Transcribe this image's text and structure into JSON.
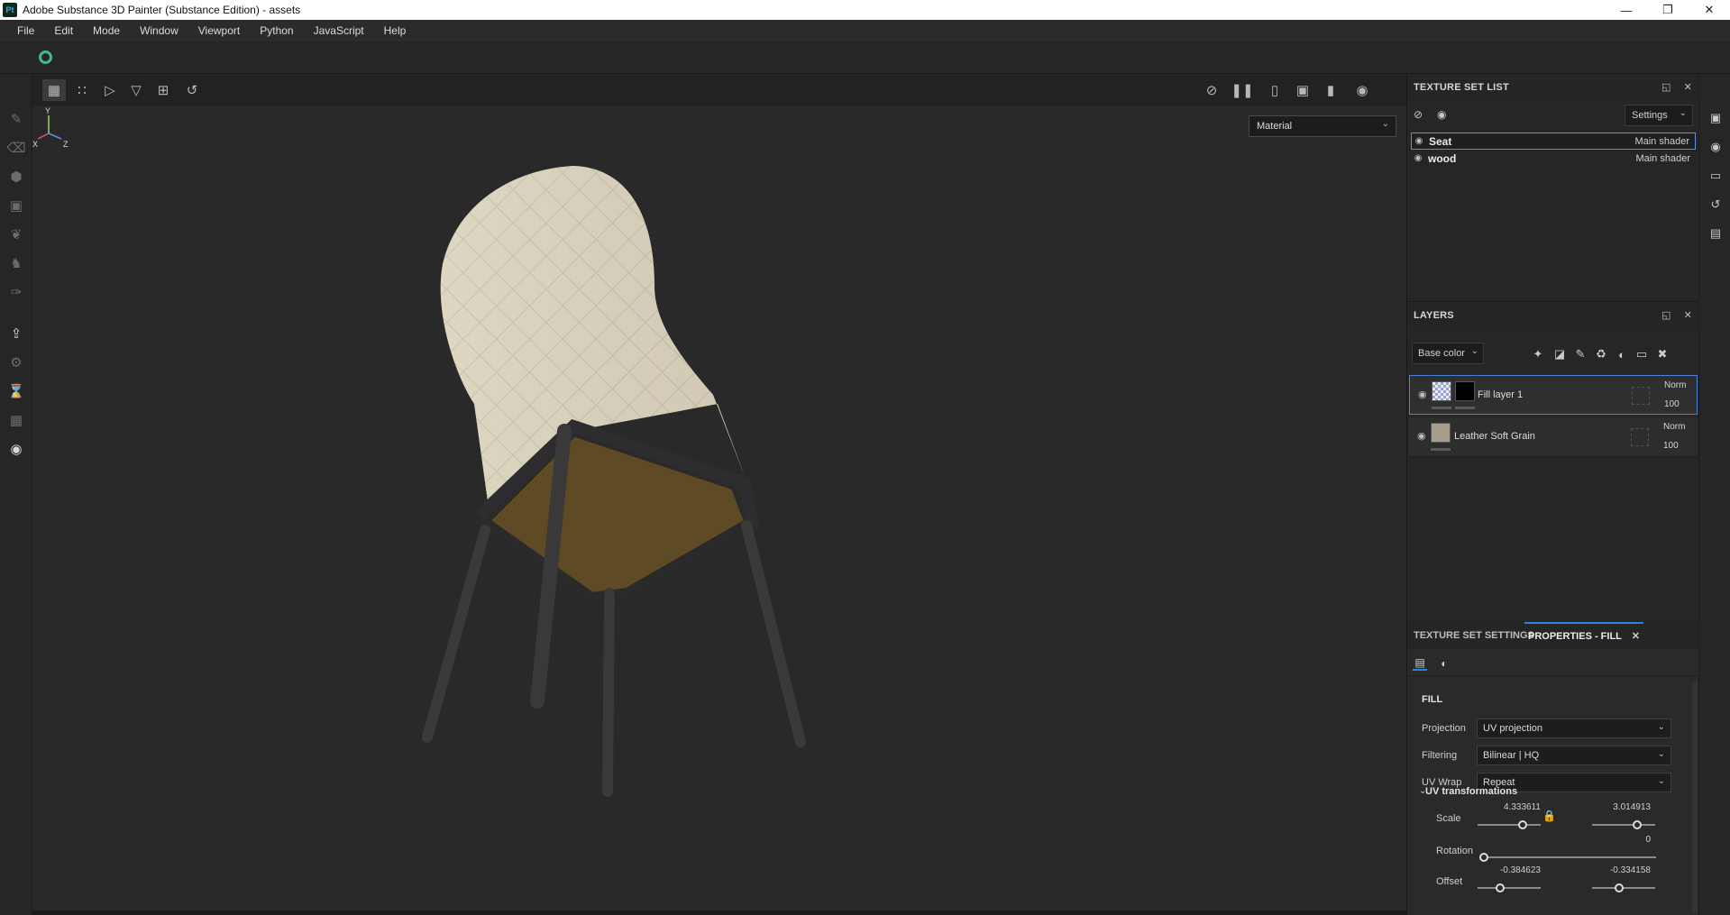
{
  "window": {
    "app_icon_text": "Pt",
    "title": "Adobe Substance 3D Painter (Substance Edition) - assets",
    "controls": [
      "minimize",
      "restore",
      "close"
    ]
  },
  "menu": [
    "File",
    "Edit",
    "Mode",
    "Window",
    "Viewport",
    "Python",
    "JavaScript",
    "Help"
  ],
  "viewport": {
    "material_dropdown": "Material",
    "axis_labels": {
      "x": "X",
      "y": "Y",
      "z": "Z"
    },
    "toolbar_left_icons": [
      "grid-view-icon",
      "multi-grid-icon",
      "mirror-x-icon",
      "mirror-y-icon",
      "add-view-icon",
      "history-icon"
    ],
    "toolbar_right_icons": [
      "hide-icon",
      "pause-icon",
      "2d-view-icon",
      "3d-view-icon",
      "camera-icon",
      "screenshot-icon"
    ]
  },
  "texture_set_list": {
    "title": "TEXTURE SET LIST",
    "settings_label": "Settings",
    "items": [
      {
        "name": "Seat",
        "shader": "Main shader",
        "selected": true
      },
      {
        "name": "wood",
        "shader": "Main shader",
        "selected": false
      }
    ]
  },
  "layers": {
    "title": "LAYERS",
    "channel": "Base color",
    "items": [
      {
        "name": "Fill layer 1",
        "blend": "Norm",
        "opacity": "100",
        "selected": true
      },
      {
        "name": "Leather Soft Grain",
        "blend": "Norm",
        "opacity": "100",
        "selected": false
      }
    ]
  },
  "properties": {
    "tab_inactive": "TEXTURE SET SETTINGS",
    "tab_active": "PROPERTIES - FILL",
    "section": "FILL",
    "projection_label": "Projection",
    "projection_value": "UV projection",
    "filtering_label": "Filtering",
    "filtering_value": "Bilinear | HQ",
    "uvwrap_label": "UV Wrap",
    "uvwrap_value": "Repeat",
    "uv_transform_title": "UV transformations",
    "scale_label": "Scale",
    "scale_u": "4.333611",
    "scale_v": "3.014913",
    "rotation_label": "Rotation",
    "rotation_value": "0",
    "offset_label": "Offset",
    "offset_u": "-0.384623",
    "offset_v": "-0.334158"
  },
  "colors": {
    "accent": "#2f83d8",
    "selection_border": "#4d7fd4",
    "sync_green": "#3dbd8a",
    "panel_bg": "#262626",
    "viewport_bg": "#292929"
  }
}
